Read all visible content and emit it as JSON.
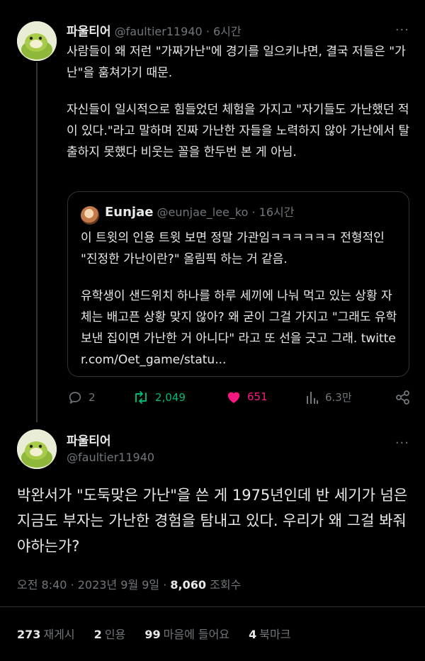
{
  "tweet": {
    "author_name": "파울티어",
    "author_handle": "@faultier11940",
    "time": "6시간",
    "more": "···",
    "text_1": "사람들이 왜 저런 \"가짜가난\"에 경기를 일으키냐면, 결국 저들은 \"가난\"을 훔쳐가기 때문.",
    "text_2": "자신들이 일시적으로 힘들었던 체험을 가지고 \"자기들도 가난했던 적이 있다.\"라고 말하며 진짜 가난한 자들을 노력하지 않아 가난에서 탈출하지 못했다 비웃는 꼴을 한두번 본 게 아님.",
    "quote": {
      "author_name": "Eunjae",
      "author_handle": "@eunjae_lee_ko",
      "time": "16시간",
      "text_1": "이 트윗의 인용 트윗 보면 정말 가관임ㅋㅋㅋㅋㅋㅋ 전형적인 \"진정한 가난이란?\" 올림픽 하는 거 같음.",
      "text_2": "유학생이 샌드위치 하나를 하루 세끼에 나눠 먹고 있는 상황 자체는 배고픈 상황 맞지 않아? 왜 굳이 그걸 가지고 \"그래도 유학 보낸 집이면 가난한 거 아니다\" 라고 또 선을 긋고 그래. twitter.com/Oet_game/statu..."
    },
    "actions": {
      "replies": "2",
      "retweets": "2,049",
      "likes": "651",
      "views": "6.3만"
    }
  },
  "reply": {
    "author_name": "파울티어",
    "author_handle": "@faultier11940",
    "text": "박완서가 \"도둑맞은 가난\"을 쓴 게 1975년인데 반 세기가 넘은 지금도 부자는 가난한 경험을 탐내고 있다. 우리가 왜 그걸 봐줘야하는가?",
    "time": "오전 8:40",
    "date": "2023년 9월 9일",
    "views_count": "8,060",
    "views_label": "조회수",
    "stats": [
      {
        "num": "273",
        "label": "재게시"
      },
      {
        "num": "2",
        "label": "인용"
      },
      {
        "num": "99",
        "label": "마음에 들어요"
      },
      {
        "num": "4",
        "label": "북마크"
      }
    ]
  },
  "colors": {
    "background": "#000000",
    "text": "#e7e9ea",
    "muted": "#71767b",
    "retweet": "#00ba7c",
    "like": "#f91880"
  }
}
